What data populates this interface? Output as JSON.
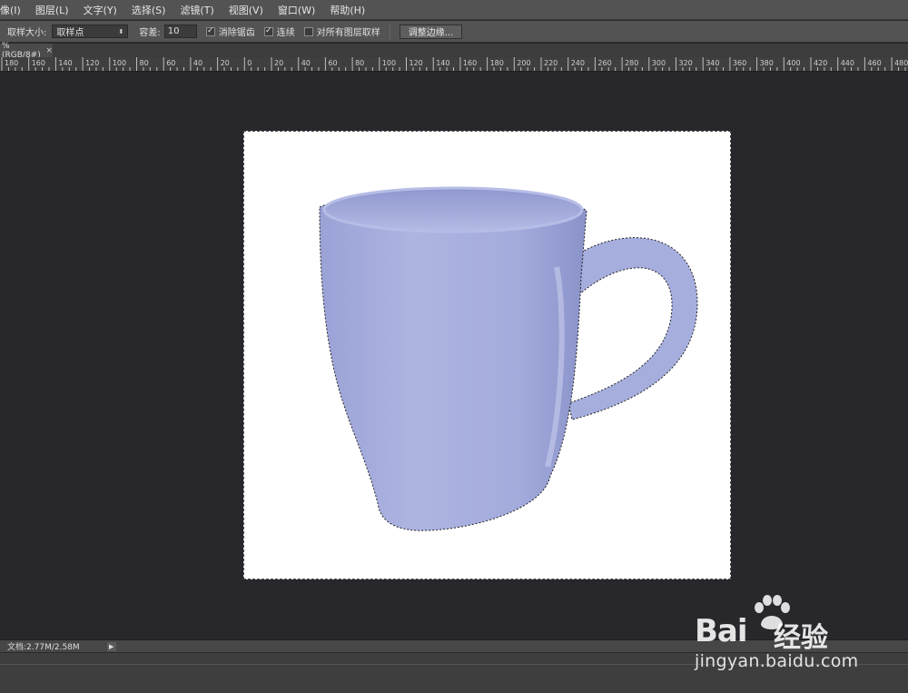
{
  "menubar": {
    "items": [
      "像(I)",
      "图层(L)",
      "文字(Y)",
      "选择(S)",
      "滤镜(T)",
      "视图(V)",
      "窗口(W)",
      "帮助(H)"
    ]
  },
  "options": {
    "sample_size_label": "取样大小:",
    "sample_size_value": "取样点",
    "tolerance_label": "容差:",
    "tolerance_value": "10",
    "antialias_label": "消除锯齿",
    "antialias_checked": true,
    "contiguous_label": "连续",
    "contiguous_checked": true,
    "all_layers_label": "对所有图层取样",
    "all_layers_checked": false,
    "refine_edge_label": "调整边缘..."
  },
  "document_tab": {
    "title": "%(RGB/8#)",
    "close_glyph": "×"
  },
  "ruler": {
    "labels": [
      "180",
      "160",
      "140",
      "120",
      "100",
      "80",
      "60",
      "40",
      "20",
      "0",
      "20",
      "40",
      "60",
      "80",
      "100",
      "120",
      "140",
      "160",
      "180",
      "200",
      "220",
      "240",
      "260",
      "280",
      "300",
      "320",
      "340",
      "360",
      "380",
      "400",
      "420",
      "440",
      "460",
      "480"
    ]
  },
  "status": {
    "doc_info": "文档:2.77M/2.58M",
    "arrow": "▶"
  },
  "watermark": {
    "brand": "Bai",
    "brand_suffix": "经验",
    "url": "jingyan.baidu.com"
  },
  "colors": {
    "mug": "#a4acdc",
    "mug_shade": "#8c95cc",
    "canvas": "#ffffff",
    "workspace": "#28272b"
  }
}
